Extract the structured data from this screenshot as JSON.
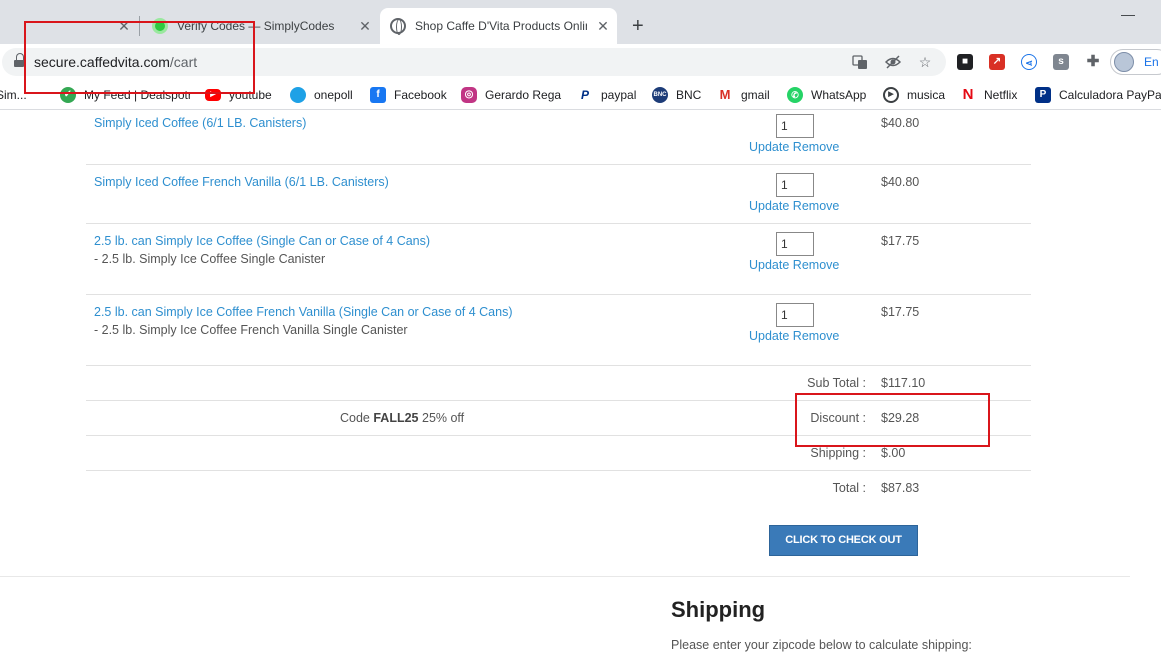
{
  "browser": {
    "tabs": [
      {
        "title": "",
        "close": "✕"
      },
      {
        "title": "Verify Codes — SimplyCodes",
        "close": "✕"
      },
      {
        "title": "Shop Caffe D'Vita Products Onlin",
        "close": "✕"
      }
    ],
    "new_tab": "+",
    "window_min": "—",
    "url_host": "secure.caffedvita.com",
    "url_path": "/cart",
    "profile_label": "En"
  },
  "bookmarks": [
    {
      "label": "Sim...",
      "icon": "bookmark-icon",
      "color": "#5f6368"
    },
    {
      "label": "My Feed | Dealspotr",
      "icon": "dealspotr-icon",
      "color": "#34a853"
    },
    {
      "label": "youtube",
      "icon": "youtube-icon",
      "color": "#ff0000"
    },
    {
      "label": "onepoll",
      "icon": "onepoll-icon",
      "color": "#1ea1e6"
    },
    {
      "label": "Facebook",
      "icon": "facebook-icon",
      "color": "#1877f2"
    },
    {
      "label": "Gerardo Rega",
      "icon": "instagram-icon",
      "color": "#c13584"
    },
    {
      "label": "paypal",
      "icon": "paypal-icon",
      "color": "#003087"
    },
    {
      "label": "BNC",
      "icon": "bnc-icon",
      "color": "#1d3c78"
    },
    {
      "label": "gmail",
      "icon": "gmail-icon",
      "color": "#d93025"
    },
    {
      "label": "WhatsApp",
      "icon": "whatsapp-icon",
      "color": "#25d366"
    },
    {
      "label": "musica",
      "icon": "music-icon",
      "color": "#3c4043"
    },
    {
      "label": "Netflix",
      "icon": "netflix-icon",
      "color": "#e50914"
    },
    {
      "label": "Calculadora PayPal",
      "icon": "calculator-icon",
      "color": "#003087"
    }
  ],
  "cart": {
    "items": [
      {
        "name": "Simply Iced Coffee (6/1 LB. Canisters)",
        "option": "",
        "qty": "1",
        "price": "$40.80"
      },
      {
        "name": "Simply Iced Coffee French Vanilla (6/1 LB. Canisters)",
        "option": "",
        "qty": "1",
        "price": "$40.80"
      },
      {
        "name": "2.5 lb. can Simply Ice Coffee (Single Can or Case of 4 Cans)",
        "option": "- 2.5 lb. Simply Ice Coffee Single Canister",
        "qty": "1",
        "price": "$17.75"
      },
      {
        "name": "2.5 lb. can Simply Ice Coffee French Vanilla (Single Can or Case of 4 Cans)",
        "option": "- 2.5 lb. Simply Ice Coffee French Vanilla Single Canister",
        "qty": "1",
        "price": "$17.75"
      }
    ],
    "update_label": "Update",
    "remove_label": "Remove",
    "subtotal_label": "Sub Total :",
    "subtotal_value": "$117.10",
    "code_prefix": "Code ",
    "code": "FALL25",
    "code_suffix": " 25% off",
    "discount_label": "Discount :",
    "discount_value": "$29.28",
    "shipping_label": "Shipping :",
    "shipping_value": "$.00",
    "total_label": "Total :",
    "total_value": "$87.83",
    "checkout_label": "CLICK TO CHECK OUT"
  },
  "shipping": {
    "title": "Shipping",
    "note": "Please enter your zipcode below to calculate shipping:"
  },
  "colors": {
    "link": "#2e8fcf",
    "button": "#3a7ab8",
    "annotation": "#d9151b"
  }
}
